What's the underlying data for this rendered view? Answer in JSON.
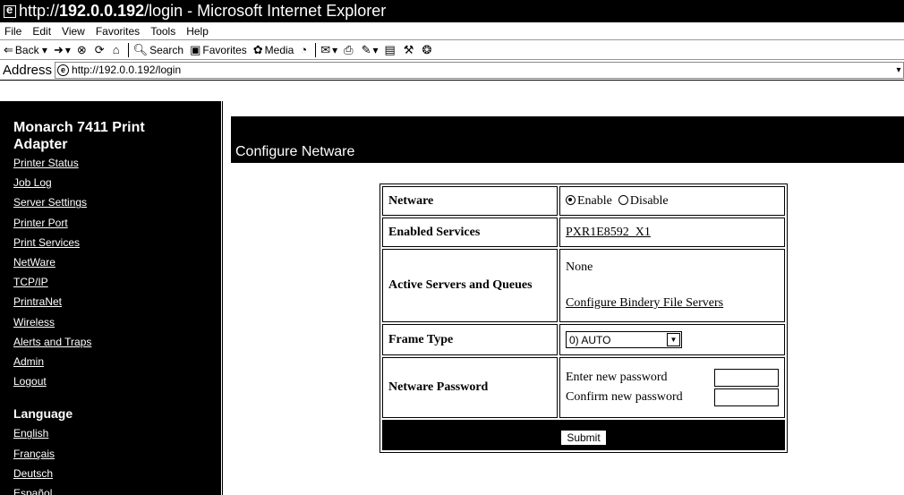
{
  "window": {
    "title_prefix": "http:// ",
    "title_host": "192.0.0.192",
    "title_suffix": " /login - Microsoft Internet Explorer"
  },
  "menu": [
    "File",
    "Edit",
    "View",
    "Favorites",
    "Tools",
    "Help"
  ],
  "toolbar": {
    "back": "Back",
    "search": "Search",
    "favorites": "Favorites",
    "media": "Media"
  },
  "address": {
    "label": "Address",
    "url": "http://192.0.0.192/login"
  },
  "sidebar": {
    "product": "Monarch 7411 Print Adapter",
    "links": [
      "Printer Status",
      "Job Log",
      "Server Settings",
      "Printer Port",
      "Print Services",
      "NetWare",
      "TCP/IP",
      "PrintraNet",
      "Wireless",
      "Alerts and Traps",
      "Admin",
      "Logout"
    ],
    "language_title": "Language",
    "languages": [
      "English",
      "Français",
      "Deutsch",
      "Español"
    ]
  },
  "page": {
    "heading": "Configure Netware"
  },
  "form": {
    "netware_label": "Netware",
    "enable_label": "Enable",
    "disable_label": "Disable",
    "enabled_services_label": "Enabled Services",
    "enabled_services_value": "PXR1E8592_X1",
    "active_servers_label": "Active Servers and Queues",
    "active_servers_value": "None",
    "configure_bindery_link": "Configure Bindery File Servers",
    "frame_type_label": "Frame Type",
    "frame_type_value": "0) AUTO",
    "password_label": "Netware Password",
    "new_password_label": "Enter new password",
    "confirm_password_label": "Confirm new password",
    "submit_label": "Submit"
  }
}
